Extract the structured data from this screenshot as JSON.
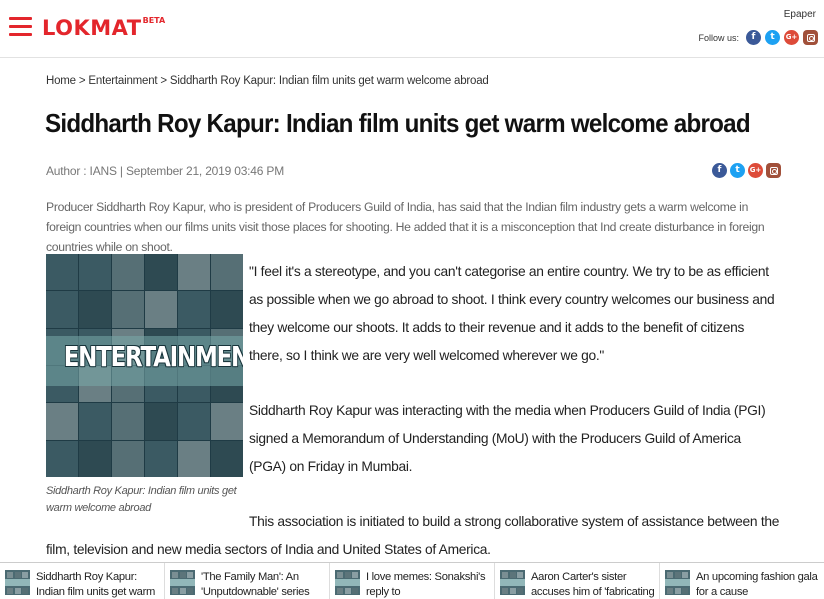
{
  "header": {
    "logo": "LOKMAT",
    "logo_badge": "BETA",
    "epaper": "Epaper",
    "follow_label": "Follow us:",
    "social": [
      "facebook-icon",
      "twitter-icon",
      "google-plus-icon",
      "instagram-icon"
    ]
  },
  "breadcrumb": {
    "home": "Home",
    "sep1": " > ",
    "section": "Entertainment",
    "sep2": " > ",
    "current": "Siddharth Roy Kapur: Indian film units get warm welcome abroad"
  },
  "article": {
    "title": "Siddharth Roy Kapur: Indian film units get warm welcome abroad",
    "meta": "Author : IANS | September 21, 2019 03:46 PM",
    "summary": "Producer Siddharth Roy Kapur, who is president of Producers Guild of India, has said that the Indian film industry gets a warm welcome in foreign countries when our films units visit those places for shooting. He added that it is a misconception that Ind create disturbance in foreign countries while on shoot.",
    "image_word": "ENTERTAINMENT",
    "caption": "Siddharth Roy Kapur: Indian film units get warm welcome abroad",
    "para1": "\"I feel it's a stereotype, and you can't categorise an entire country. We try to be as efficient as possible when we go abroad to shoot. I think every country welcomes our business and they welcome our shoots. It adds to their revenue and it adds to the benefit of citizens there, so I think we are very well welcomed wherever we go.\"",
    "para2": "Siddharth Roy Kapur was interacting with the media when Producers Guild of India (PGI) signed a Memorandum of Understanding (MoU) with the Producers Guild of America (PGA) on Friday in Mumbai.",
    "para3": "This association is initiated to build a strong collaborative system of assistance between the film, television and new media sectors of India and United States of America."
  },
  "colors": {
    "brand_red": "#e3262c",
    "facebook": "#3b5998",
    "twitter": "#1da1f2",
    "google_plus": "#dd4b39",
    "instagram": "#a1503a"
  },
  "related": [
    {
      "text": "Siddharth Roy Kapur: Indian film units get warm welcome"
    },
    {
      "text": "'The Family Man': An 'Unputdownable' series"
    },
    {
      "text": "I love memes: Sonakshi's reply to #YoSonakshiSoDumb"
    },
    {
      "text": "Aaron Carter's sister accuses him of 'fabricating stories'"
    },
    {
      "text": "An upcoming fashion gala for a cause"
    }
  ]
}
